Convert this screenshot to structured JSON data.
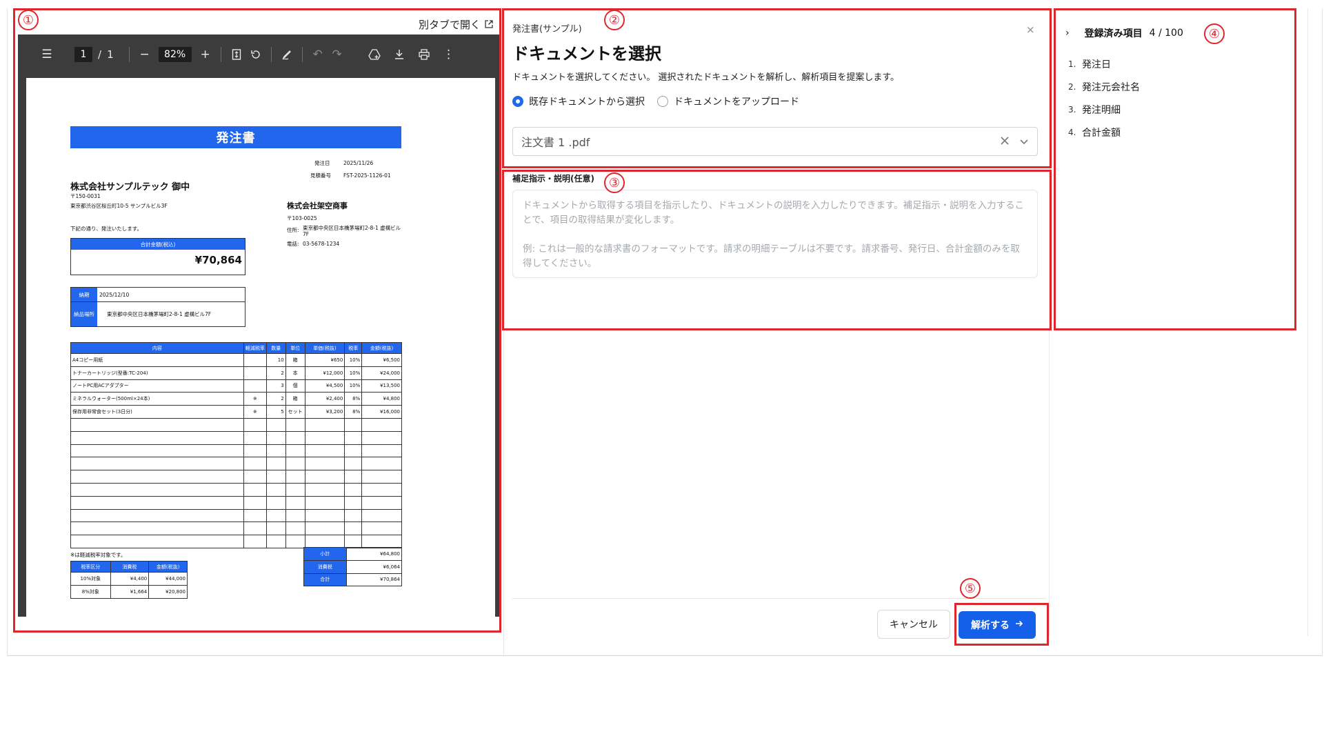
{
  "viewer": {
    "open_new_tab": "別タブで開く",
    "page_current": "1",
    "page_sep": "/",
    "page_total": "1",
    "zoom": "82%"
  },
  "document": {
    "title": "発注書",
    "order_date_label": "発注日",
    "order_date": "2025/11/26",
    "quote_no_label": "見積番号",
    "quote_no": "FST-2025-1126-01",
    "to_company": "株式会社サンプルテック 御中",
    "to_zip": "〒150-0031",
    "to_address": "東京都渋谷区桜丘町10-5 サンプルビル3F",
    "from_company": "株式会社架空商事",
    "from_zip": "〒103-0025",
    "from_address_label": "住所:",
    "from_address": "東京都中央区日本橋茅場町2-8-1 虚構ビル7F",
    "from_tel_label": "電話:",
    "from_tel": "03-5678-1234",
    "intro": "下記の通り、発注いたします。",
    "total_label": "合計金額(税込)",
    "total_value": "¥70,864",
    "delivery_date_label": "納期",
    "delivery_date": "2025/12/10",
    "delivery_place_label": "納品場所",
    "delivery_place": "東京都中央区日本橋茅場町2-8-1 虚構ビル7F",
    "table_headers": [
      "内容",
      "軽減税率",
      "数量",
      "単位",
      "単価(税抜)",
      "税率",
      "金額(税抜)"
    ],
    "rows": [
      [
        "A4コピー用紙",
        "",
        "10",
        "箱",
        "¥650",
        "10%",
        "¥6,500"
      ],
      [
        "トナーカートリッジ(型番:TC-204)",
        "",
        "2",
        "本",
        "¥12,000",
        "10%",
        "¥24,000"
      ],
      [
        "ノートPC用ACアダプター",
        "",
        "3",
        "個",
        "¥4,500",
        "10%",
        "¥13,500"
      ],
      [
        "ミネラルウォーター(500ml×24本)",
        "※",
        "2",
        "箱",
        "¥2,400",
        "8%",
        "¥4,800"
      ],
      [
        "保存用非常食セット(3日分)",
        "※",
        "5",
        "セット",
        "¥3,200",
        "8%",
        "¥16,000"
      ]
    ],
    "reduced_note": "※は軽減税率対象です。",
    "tax_headers": [
      "税率区分",
      "消費税",
      "金額(税抜)"
    ],
    "tax_rows": [
      [
        "10%対象",
        "¥4,400",
        "¥44,000"
      ],
      [
        "8%対象",
        "¥1,664",
        "¥20,800"
      ]
    ],
    "summary": [
      [
        "小計",
        "¥64,800"
      ],
      [
        "消費税",
        "¥6,064"
      ],
      [
        "合計",
        "¥70,864"
      ]
    ]
  },
  "dialog": {
    "subtitle": "発注書(サンプル)",
    "close": "×",
    "title": "ドキュメントを選択",
    "description": "ドキュメントを選択してください。 選択されたドキュメントを解析し、解析項目を提案します。",
    "radio_existing": "既存ドキュメントから選択",
    "radio_upload": "ドキュメントをアップロード",
    "selected_file": "注文書 1 .pdf",
    "notes_label": "補足指示・説明(任意)",
    "notes_placeholder": "ドキュメントから取得する項目を指示したり、ドキュメントの説明を入力したりできます。補足指示・説明を入力することで、項目の取得結果が変化します。\n\n例: これは一般的な請求書のフォーマットです。請求の明細テーブルは不要です。請求番号、発行日、合計金額のみを取得してください。",
    "cancel": "キャンセル",
    "analyze": "解析する"
  },
  "registered": {
    "title": "登録済み項目",
    "count": "4 / 100",
    "items": [
      {
        "index": "1.",
        "label": "発注日"
      },
      {
        "index": "2.",
        "label": "発注元会社名"
      },
      {
        "index": "3.",
        "label": "発注明細"
      },
      {
        "index": "4.",
        "label": "合計金額"
      }
    ]
  },
  "annotations": {
    "n1": "①",
    "n2": "②",
    "n3": "③",
    "n4": "④",
    "n5": "⑤"
  },
  "colors": {
    "accent": "#1560e8",
    "doc_blue": "#2266ee",
    "annotation_red": "#e0262d",
    "viewer_dark": "#3c3c3c"
  }
}
